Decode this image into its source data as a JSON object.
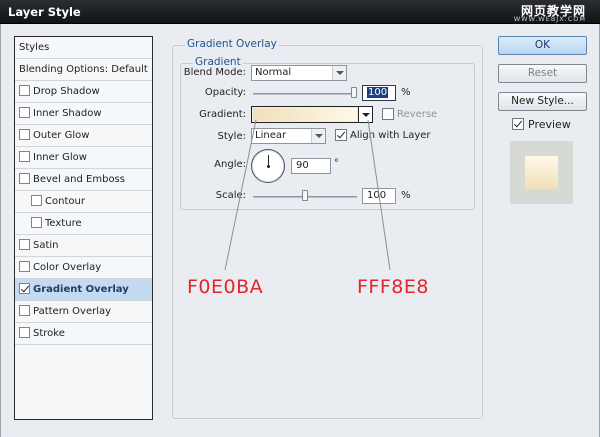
{
  "window": {
    "title": "Layer Style",
    "watermark_cn": "网页教学网",
    "watermark_url": "WWW.WEBJX.COM"
  },
  "styles_list": {
    "items": [
      {
        "label": "Styles",
        "checkbox": false,
        "checked": false,
        "selected": false,
        "indent": false
      },
      {
        "label": "Blending Options: Default",
        "checkbox": false,
        "checked": false,
        "selected": false,
        "indent": false
      },
      {
        "label": "Drop Shadow",
        "checkbox": true,
        "checked": false,
        "selected": false,
        "indent": false
      },
      {
        "label": "Inner Shadow",
        "checkbox": true,
        "checked": false,
        "selected": false,
        "indent": false
      },
      {
        "label": "Outer Glow",
        "checkbox": true,
        "checked": false,
        "selected": false,
        "indent": false
      },
      {
        "label": "Inner Glow",
        "checkbox": true,
        "checked": false,
        "selected": false,
        "indent": false
      },
      {
        "label": "Bevel and Emboss",
        "checkbox": true,
        "checked": false,
        "selected": false,
        "indent": false
      },
      {
        "label": "Contour",
        "checkbox": true,
        "checked": false,
        "selected": false,
        "indent": true
      },
      {
        "label": "Texture",
        "checkbox": true,
        "checked": false,
        "selected": false,
        "indent": true
      },
      {
        "label": "Satin",
        "checkbox": true,
        "checked": false,
        "selected": false,
        "indent": false
      },
      {
        "label": "Color Overlay",
        "checkbox": true,
        "checked": false,
        "selected": false,
        "indent": false
      },
      {
        "label": "Gradient Overlay",
        "checkbox": true,
        "checked": true,
        "selected": true,
        "indent": false
      },
      {
        "label": "Pattern Overlay",
        "checkbox": true,
        "checked": false,
        "selected": false,
        "indent": false
      },
      {
        "label": "Stroke",
        "checkbox": true,
        "checked": false,
        "selected": false,
        "indent": false
      }
    ]
  },
  "gradient_overlay": {
    "group_title": "Gradient Overlay",
    "subgroup_title": "Gradient",
    "blend_mode_label": "Blend Mode:",
    "blend_mode_value": "Normal",
    "opacity_label": "Opacity:",
    "opacity_value": "100",
    "opacity_unit": "%",
    "opacity_level": 1.0,
    "gradient_label": "Gradient:",
    "gradient_start_color": "#F0E0BA",
    "gradient_end_color": "#FFF8E8",
    "reverse_label": "Reverse",
    "reverse_checked": false,
    "style_label": "Style:",
    "style_value": "Linear",
    "align_label": "Align with Layer",
    "align_checked": true,
    "angle_label": "Angle:",
    "angle_value": "90",
    "angle_unit": "°",
    "scale_label": "Scale:",
    "scale_value": "100",
    "scale_unit": "%",
    "scale_level_percent": 100
  },
  "annotations": {
    "left_color": "F0E0BA",
    "right_color": "FFF8E8",
    "color": "#E2262B"
  },
  "buttons": {
    "ok": "OK",
    "reset": "Reset",
    "new_style": "New Style...",
    "preview_label": "Preview",
    "preview_checked": true
  }
}
